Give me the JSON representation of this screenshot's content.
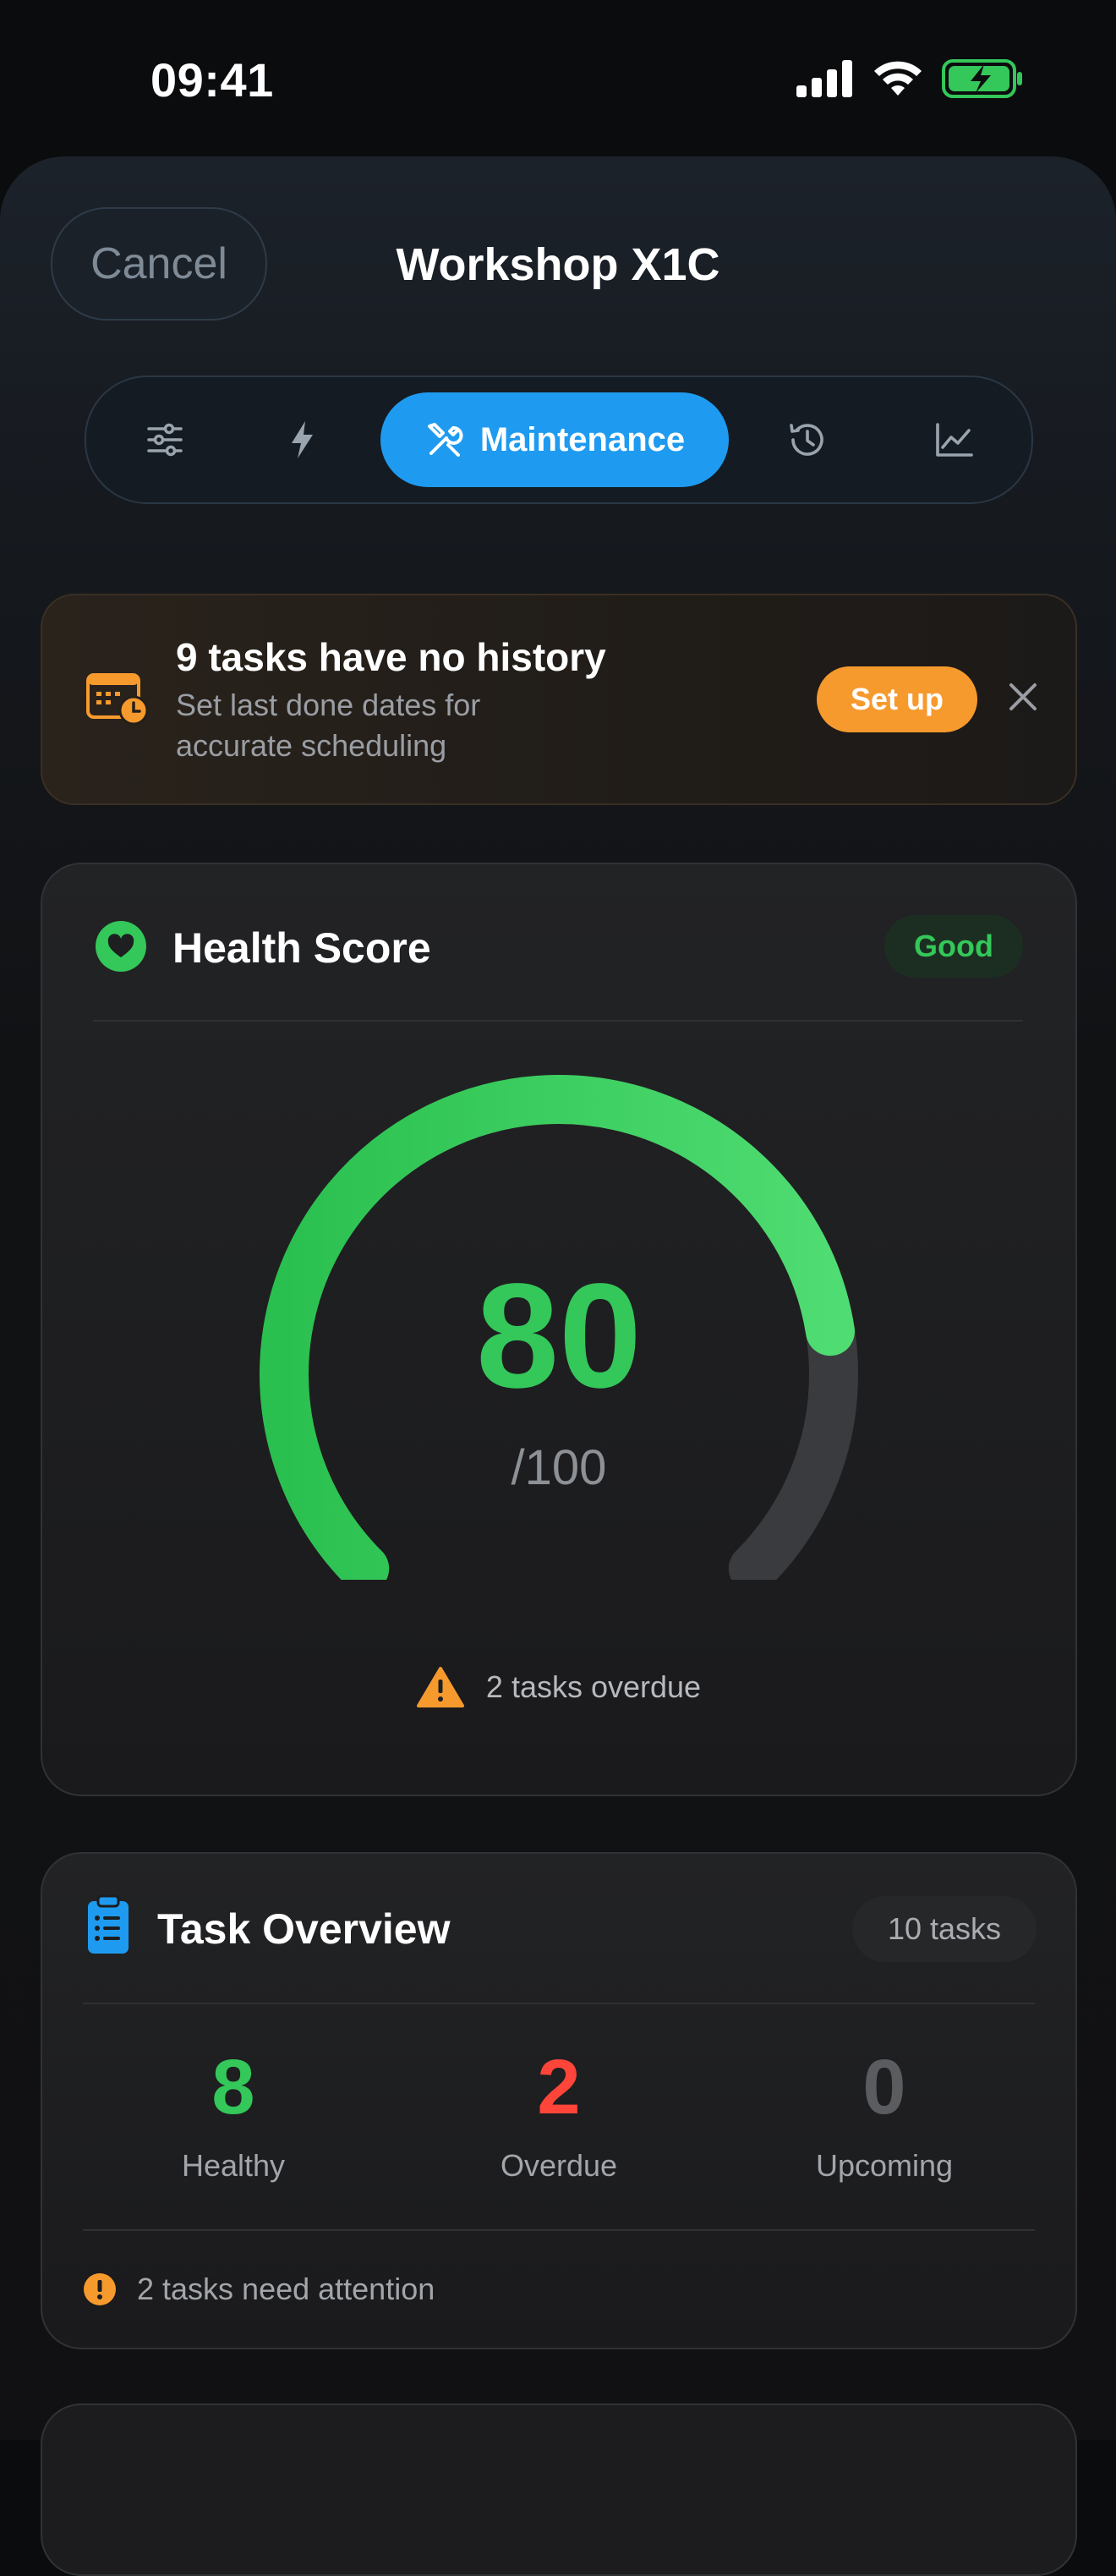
{
  "status_bar": {
    "time": "09:41"
  },
  "header": {
    "cancel_label": "Cancel",
    "title": "Workshop X1C"
  },
  "tabs": {
    "items": [
      {
        "icon": "sliders-icon"
      },
      {
        "icon": "bolt-icon"
      },
      {
        "icon": "tools-icon",
        "label": "Maintenance",
        "active": true
      },
      {
        "icon": "history-icon"
      },
      {
        "icon": "chart-icon"
      }
    ],
    "active_label": "Maintenance"
  },
  "banner": {
    "title": "9 tasks have no history",
    "subtitle": "Set last done dates for accurate scheduling",
    "button_label": "Set up"
  },
  "health": {
    "title": "Health Score",
    "status": "Good",
    "score": "80",
    "out_of": "/100",
    "score_fraction": 0.8,
    "overdue_note": "2 tasks overdue"
  },
  "tasks": {
    "title": "Task Overview",
    "count_label": "10 tasks",
    "stats": [
      {
        "value": "8",
        "label": "Healthy"
      },
      {
        "value": "2",
        "label": "Overdue"
      },
      {
        "value": "0",
        "label": "Upcoming"
      }
    ],
    "attention_note": "2 tasks need attention"
  },
  "colors": {
    "accent_blue": "#1e9bf0",
    "green": "#34c759",
    "red": "#ff453a",
    "orange": "#f79a2e",
    "gray": "#5a5c60"
  }
}
